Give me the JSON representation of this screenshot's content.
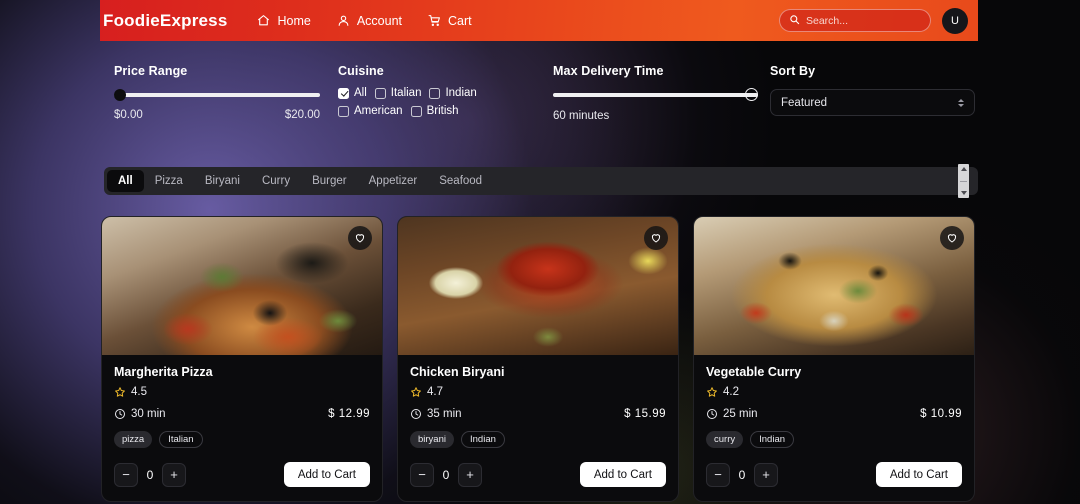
{
  "header": {
    "brand": "FoodieExpress",
    "nav": [
      {
        "label": "Home",
        "icon": "home-icon"
      },
      {
        "label": "Account",
        "icon": "user-icon"
      },
      {
        "label": "Cart",
        "icon": "cart-icon"
      }
    ],
    "search": {
      "value": "",
      "placeholder": "Search..."
    },
    "avatar_initial": "U",
    "accent": "#e8441c"
  },
  "filters": {
    "price": {
      "label": "Price Range",
      "min_label": "$0.00",
      "max_label": "$20.00",
      "handle_percent": 0
    },
    "cuisine": {
      "label": "Cuisine",
      "options": [
        {
          "label": "All",
          "checked": true
        },
        {
          "label": "Italian",
          "checked": false
        },
        {
          "label": "Indian",
          "checked": false
        },
        {
          "label": "American",
          "checked": false
        },
        {
          "label": "British",
          "checked": false
        }
      ]
    },
    "delivery": {
      "label": "Max Delivery Time",
      "value_label": "60 minutes",
      "handle_percent": 100
    },
    "sort": {
      "label": "Sort By",
      "selected": "Featured"
    }
  },
  "categories": {
    "tabs": [
      {
        "label": "All",
        "active": true
      },
      {
        "label": "Pizza",
        "active": false
      },
      {
        "label": "Biryani",
        "active": false
      },
      {
        "label": "Curry",
        "active": false
      },
      {
        "label": "Burger",
        "active": false
      },
      {
        "label": "Appetizer",
        "active": false
      },
      {
        "label": "Seafood",
        "active": false
      }
    ]
  },
  "cards": [
    {
      "title": "Margherita Pizza",
      "rating": "4.5",
      "time": "30 min",
      "price": "$  12.99",
      "tags": [
        "pizza",
        "Italian"
      ],
      "quantity": "0",
      "add_label": "Add to Cart",
      "photo": "pizza"
    },
    {
      "title": "Chicken Biryani",
      "rating": "4.7",
      "time": "35 min",
      "price": "$  15.99",
      "tags": [
        "biryani",
        "Indian"
      ],
      "quantity": "0",
      "add_label": "Add to Cart",
      "photo": "biryani"
    },
    {
      "title": "Vegetable Curry",
      "rating": "4.2",
      "time": "25 min",
      "price": "$  10.99",
      "tags": [
        "curry",
        "Indian"
      ],
      "quantity": "0",
      "add_label": "Add to Cart",
      "photo": "curry"
    }
  ]
}
